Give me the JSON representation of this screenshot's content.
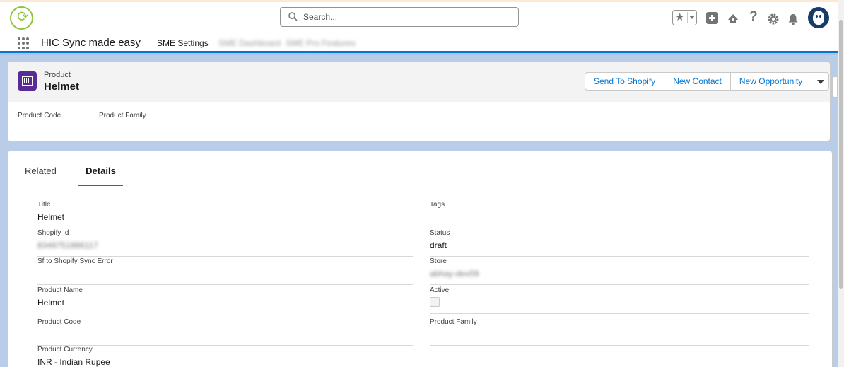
{
  "header": {
    "search_placeholder": "Search...",
    "icons": [
      "app-logo-icon",
      "search-icon",
      "favorites-star-icon",
      "chevron-down-icon",
      "global-actions-plus-icon",
      "trailhead-icon",
      "help-icon",
      "setup-gear-icon",
      "notifications-bell-icon",
      "user-avatar"
    ]
  },
  "nav": {
    "app_name": "HIC Sync made easy",
    "items": [
      {
        "label": "SME Settings",
        "blurred": false
      },
      {
        "label": "SME Dashboard",
        "blurred": true
      },
      {
        "label": "SME Pro Features",
        "blurred": true
      }
    ]
  },
  "record": {
    "object_label": "Product",
    "name": "Helmet",
    "actions": [
      "Send To Shopify",
      "New Contact",
      "New Opportunity"
    ],
    "highlight_fields": [
      "Product Code",
      "Product Family"
    ]
  },
  "tabs": {
    "related": "Related",
    "details": "Details",
    "active": "Details"
  },
  "details": {
    "left": [
      {
        "label": "Title",
        "value": "Helmet"
      },
      {
        "label": "Shopify Id",
        "value": "8349751886117",
        "blurred": true
      },
      {
        "label": "Sf to Shopify Sync Error",
        "value": ""
      },
      {
        "label": "Product Name",
        "value": "Helmet"
      },
      {
        "label": "Product Code",
        "value": ""
      },
      {
        "label": "Product Currency",
        "value": "INR - Indian Rupee"
      }
    ],
    "right": [
      {
        "label": "Tags",
        "value": ""
      },
      {
        "label": "Status",
        "value": "draft"
      },
      {
        "label": "Store",
        "value": "abhay-dev09",
        "blurred": true
      },
      {
        "label": "Active",
        "value": "",
        "checkbox": false
      },
      {
        "label": "Product Family",
        "value": ""
      }
    ]
  },
  "colors": {
    "brand_blue": "#0176d3",
    "product_icon": "#5a2a97",
    "page_background": "#b9cde8"
  }
}
